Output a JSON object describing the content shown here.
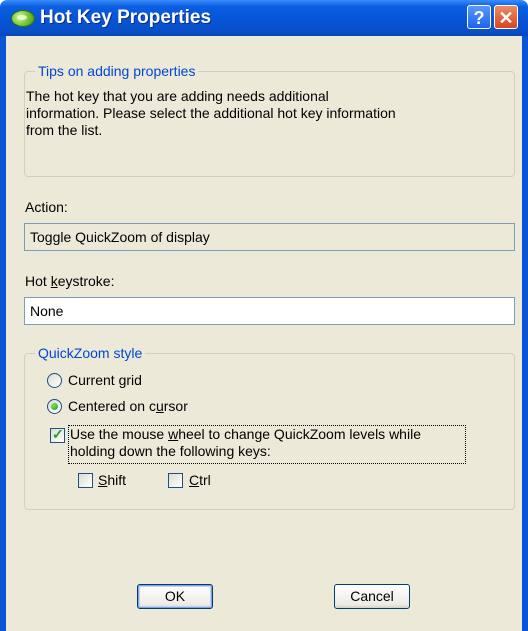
{
  "window": {
    "title": "Hot Key Properties",
    "help_glyph": "?",
    "close_glyph": "✕"
  },
  "tips": {
    "legend": "Tips on adding properties",
    "line1": "The hot key that you are adding needs additional",
    "line2": "information. Please select the additional hot key information",
    "line3": "from the list."
  },
  "action": {
    "label": "Action:",
    "value": "Toggle QuickZoom of display"
  },
  "hotkey": {
    "label_prefix": "Hot ",
    "label_mnemonic": "k",
    "label_suffix": "eystroke:",
    "value": "None"
  },
  "quickzoom": {
    "legend": "QuickZoom style",
    "option_current_grid": "Current grid",
    "option_centered_prefix": "Centered on c",
    "option_centered_mnemonic": "u",
    "option_centered_suffix": "rsor",
    "selected": "Centered on cursor",
    "wheel_line1_prefix": "Use the mouse ",
    "wheel_line1_mnemonic": "w",
    "wheel_line1_suffix": "heel to change QuickZoom levels while",
    "wheel_line2": "holding down the following keys:",
    "wheel_checked": true,
    "shift_mnemonic": "S",
    "shift_rest": "hift",
    "shift_checked": false,
    "ctrl_mnemonic": "C",
    "ctrl_rest": "trl",
    "ctrl_checked": false
  },
  "buttons": {
    "ok": "OK",
    "cancel": "Cancel"
  },
  "colors": {
    "titlebar": "#0654d8",
    "face": "#ece9d8",
    "legend": "#0046d5",
    "close": "#d5461f"
  }
}
